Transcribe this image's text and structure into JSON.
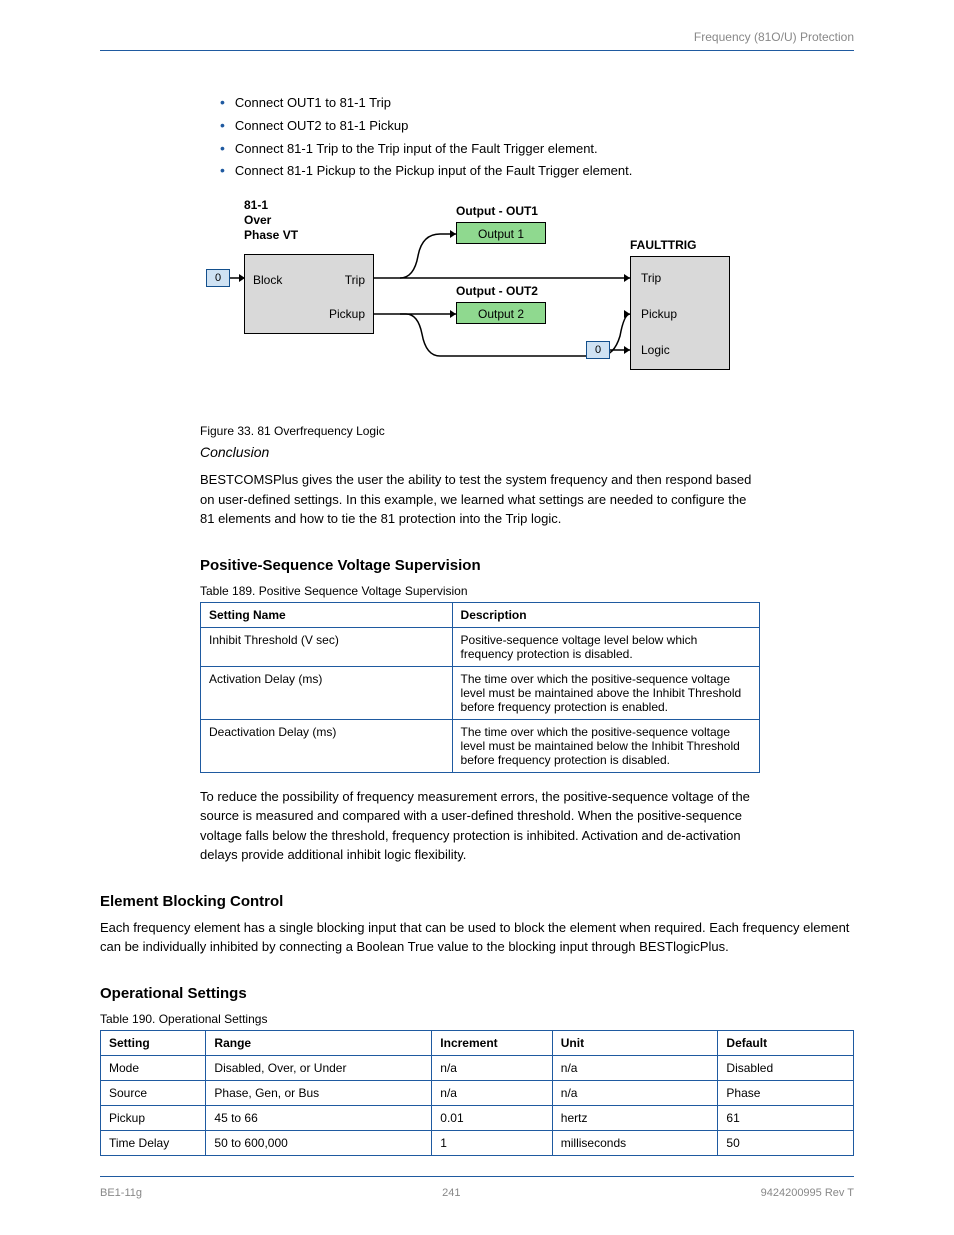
{
  "header_right": "Frequency (81O/U) Protection",
  "bullets": [
    "Connect OUT1 to 81-1 Trip",
    "Connect OUT2 to 81-1 Pickup",
    "Connect 81-1 Trip to the Trip input of the Fault Trigger element.",
    "Connect 81-1 Pickup to the Pickup input of the Fault Trigger element."
  ],
  "diagram": {
    "title_81": "81-1\nOver\nPhase VT",
    "block_box": {
      "block": "Block",
      "trip": "Trip",
      "pickup": "Pickup"
    },
    "in0": "0",
    "out1_title": "Output - OUT1",
    "out1_box": "Output 1",
    "out2_title": "Output - OUT2",
    "out2_box": "Output 2",
    "faulttrig_title": "FAULTTRIG",
    "faulttrig_ports": {
      "trip": "Trip",
      "pickup": "Pickup",
      "logic": "Logic"
    },
    "in0_b": "0"
  },
  "fig_caption": "Figure 33. 81 Overfrequency Logic",
  "conclusion_title": "Conclusion",
  "conclusion_body": "BESTCOMSPlus gives the user the ability to test the system frequency and then respond based on user-defined settings. In this example, we learned what settings are needed to configure the 81 elements and how to tie the 81 protection into the Trip logic.",
  "positive_seq_title": "Positive-Sequence Voltage Supervision",
  "positive_seq_table_caption": "Table 189. Positive Sequence Voltage Supervision",
  "positive_seq_table": {
    "headers": [
      "Setting Name",
      "Description"
    ],
    "rows": [
      [
        "Inhibit Threshold (V sec)",
        "Positive-sequence voltage level below which frequency protection is disabled."
      ],
      [
        "Activation Delay (ms)",
        "The time over which the positive-sequence voltage level must be maintained above the Inhibit Threshold before frequency protection is enabled."
      ],
      [
        "Deactivation Delay (ms)",
        "The time over which the positive-sequence voltage level must be maintained below the Inhibit Threshold before frequency protection is disabled."
      ]
    ]
  },
  "positive_seq_body": "To reduce the possibility of frequency measurement errors, the positive-sequence voltage of the source is measured and compared with a user-defined threshold. When the positive-sequence voltage falls below the threshold, frequency protection is inhibited. Activation and de-activation delays provide additional inhibit logic flexibility.",
  "element_title": "Element Blocking Control",
  "element_body": "Each frequency element has a single blocking input that can be used to block the element when required. Each frequency element can be individually inhibited by connecting a Boolean True value to the blocking input through BESTlogicPlus.",
  "op_settings_title": "Operational Settings",
  "table2_caption": "Table 190. Operational Settings",
  "table2": {
    "headers": [
      "Setting",
      "Range",
      "Increment",
      "Unit",
      "Default"
    ],
    "rows": [
      [
        "Mode",
        "Disabled, Over, or Under",
        "n/a",
        "n/a",
        "Disabled"
      ],
      [
        "Source",
        "Phase, Gen, or Bus",
        "n/a",
        "n/a",
        "Phase"
      ],
      [
        "Pickup",
        "45 to 66",
        "0.01",
        "hertz",
        "61"
      ],
      [
        "Time Delay",
        "50 to 600,000",
        "1",
        "milliseconds",
        "50"
      ]
    ]
  },
  "footer_left": "BE1-11g",
  "footer_right": "9424200995 Rev T",
  "page_number": "241"
}
